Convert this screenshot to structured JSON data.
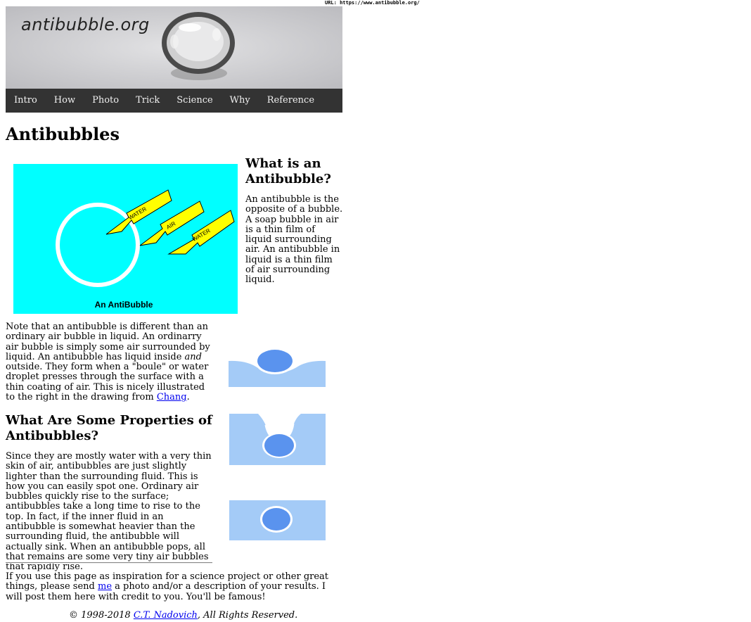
{
  "url_bar": {
    "label": "URL:",
    "url": "https://www.antibubble.org/"
  },
  "banner": {
    "logo_text": "antibubble.org"
  },
  "nav": {
    "items": [
      "Intro",
      "How",
      "Photo",
      "Trick",
      "Science",
      "Why",
      "Reference"
    ]
  },
  "page_title": "Antibubbles",
  "diagram": {
    "caption": "An AntiBubble",
    "arrow_labels": [
      "WATER",
      "AIR",
      "WATER"
    ],
    "colors": {
      "background": "#00ffff",
      "arrow": "#ffff00"
    }
  },
  "what_is": {
    "heading": "What is an Antibubble?",
    "body": "An antibubble is the opposite of a bubble. A soap bubble in air is a thin film of liquid surrounding air. An antibubble in liquid is a thin film of air surrounding liquid."
  },
  "note": {
    "before_em": "Note that an antibubble is different than an ordinary air bubble in liquid. An ordinarry air bubble is simply some air surrounded by liquid. An antibubble has liquid inside ",
    "em": "and",
    "after_em": " outside. They form when a \"boule\" or water droplet presses through the surface with a thin coating of air. This is nicely illustrated to the right in the drawing from ",
    "link": "Chang",
    "end": "."
  },
  "properties": {
    "heading": "What Are Some Properties of Antibubbles?",
    "body": "Since they are mostly water with a very thin skin of air, antibubbles are just slightly lighter than the surrounding fluid. This is how you can easily spot one. Ordinary air bubbles quickly rise to the surface; antibubbles take a long time to rise to the top. In fact, if the inner fluid in an antibubble is somewhat heavier than the surrounding fluid, the antibubble will actually sink. When an antibubble pops, all that remains are some very tiny air bubbles that rapidly rise."
  },
  "inspire": {
    "before_link": "If you use this page as inspiration for a science project or other great things, please send ",
    "link": "me",
    "after_link": " a photo and/or a description of your results. I will post them here with credit to you. You'll be famous!"
  },
  "footer": {
    "prefix": "© 1998-2018 ",
    "link": "C.T. Nadovich",
    "suffix": ", All Rights Reserved."
  }
}
